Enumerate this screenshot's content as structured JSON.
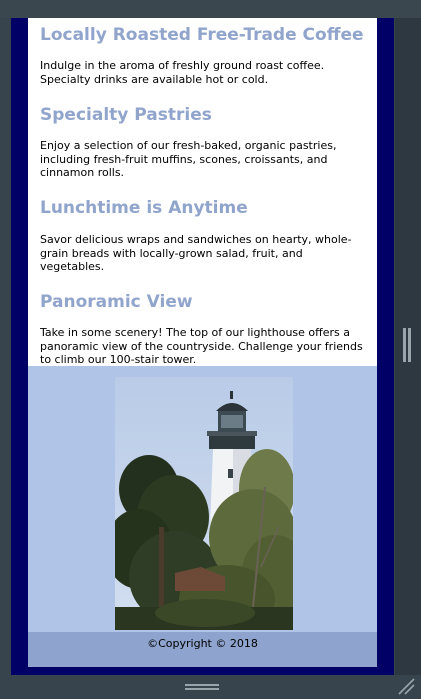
{
  "sections": [
    {
      "heading": "Locally Roasted Free-Trade Coffee",
      "text": "Indulge in the aroma of freshly ground roast coffee. Specialty drinks are available hot or cold."
    },
    {
      "heading": "Specialty Pastries",
      "text": "Enjoy a selection of our fresh-baked, organic pastries, including fresh-fruit muffins, scones, croissants, and cinnamon rolls."
    },
    {
      "heading": "Lunchtime is Anytime",
      "text": "Savor delicious wraps and sandwiches on hearty, whole-grain breads with locally-grown salad, fruit, and vegetables."
    },
    {
      "heading": "Panoramic View",
      "text": "Take in some scenery! The top of our lighthouse offers a panoramic view of the countryside. Challenge your friends to climb our 100-stair tower."
    }
  ],
  "footer": {
    "copyright": "©Copyright © 2018"
  },
  "colors": {
    "page_background": "#000066",
    "heading": "#90a4cc",
    "image_background": "#b0c4e8",
    "footer_background": "#8ea3cd"
  },
  "icons": {
    "scroll_handle": "vertical-grip-icon",
    "bottom_handle": "horizontal-grip-icon",
    "resize": "resize-grip-icon"
  }
}
